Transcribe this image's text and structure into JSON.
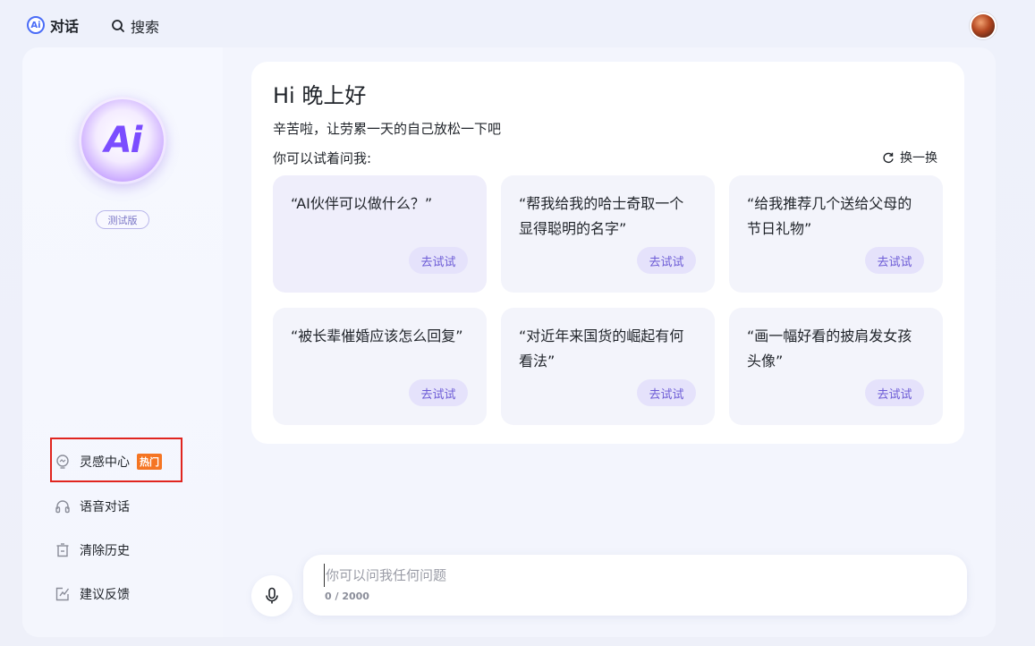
{
  "topbar": {
    "logo_text": "Ai",
    "chat_label": "对话",
    "search_label": "搜索"
  },
  "sidebar": {
    "logo_text": "Ai",
    "version_badge": "测试版",
    "menu": [
      {
        "label": "灵感中心",
        "icon": "lightbulb-icon",
        "badge": "热门"
      },
      {
        "label": "语音对话",
        "icon": "headphones-icon"
      },
      {
        "label": "清除历史",
        "icon": "trash-icon"
      },
      {
        "label": "建议反馈",
        "icon": "feedback-icon"
      }
    ]
  },
  "greeting": {
    "title": "Hi 晚上好",
    "subtitle": "辛苦啦，让劳累一天的自己放松一下吧",
    "suggest_label": "你可以试着问我:",
    "refresh_label": "换一换"
  },
  "suggestions": [
    {
      "text": "“AI伙伴可以做什么？”",
      "button": "去试试"
    },
    {
      "text": "“帮我给我的哈士奇取一个显得聪明的名字”",
      "button": "去试试"
    },
    {
      "text": "“给我推荐几个送给父母的节日礼物”",
      "button": "去试试"
    },
    {
      "text": "“被长辈催婚应该怎么回复”",
      "button": "去试试"
    },
    {
      "text": "“对近年来国货的崛起有何看法”",
      "button": "去试试"
    },
    {
      "text": "“画一幅好看的披肩发女孩头像”",
      "button": "去试试"
    }
  ],
  "input": {
    "placeholder": "你可以问我任何问题",
    "value": "",
    "counter": "0 / 2000"
  },
  "colors": {
    "accent": "#6c5bd6",
    "hot_badge": "#f57523",
    "highlight_border": "#e0251f"
  }
}
